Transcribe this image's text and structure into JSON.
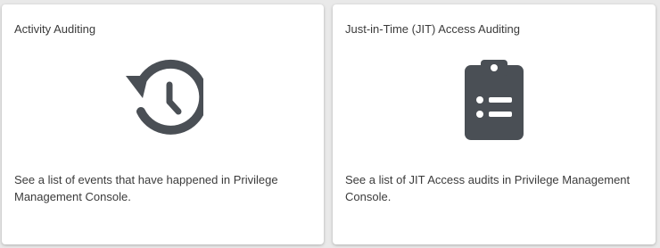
{
  "cards": [
    {
      "title": "Activity Auditing",
      "icon": "history-icon",
      "description": "See a list of events that have happened in Privilege Management Console."
    },
    {
      "title": "Just-in-Time (JIT) Access Auditing",
      "icon": "clipboard-list-icon",
      "description": "See a list of JIT Access audits in Privilege Management Console."
    }
  ],
  "colors": {
    "icon": "#4a4f55",
    "text": "#3b3b3b",
    "card_bg": "#ffffff",
    "page_bg": "#e9e9e9"
  }
}
